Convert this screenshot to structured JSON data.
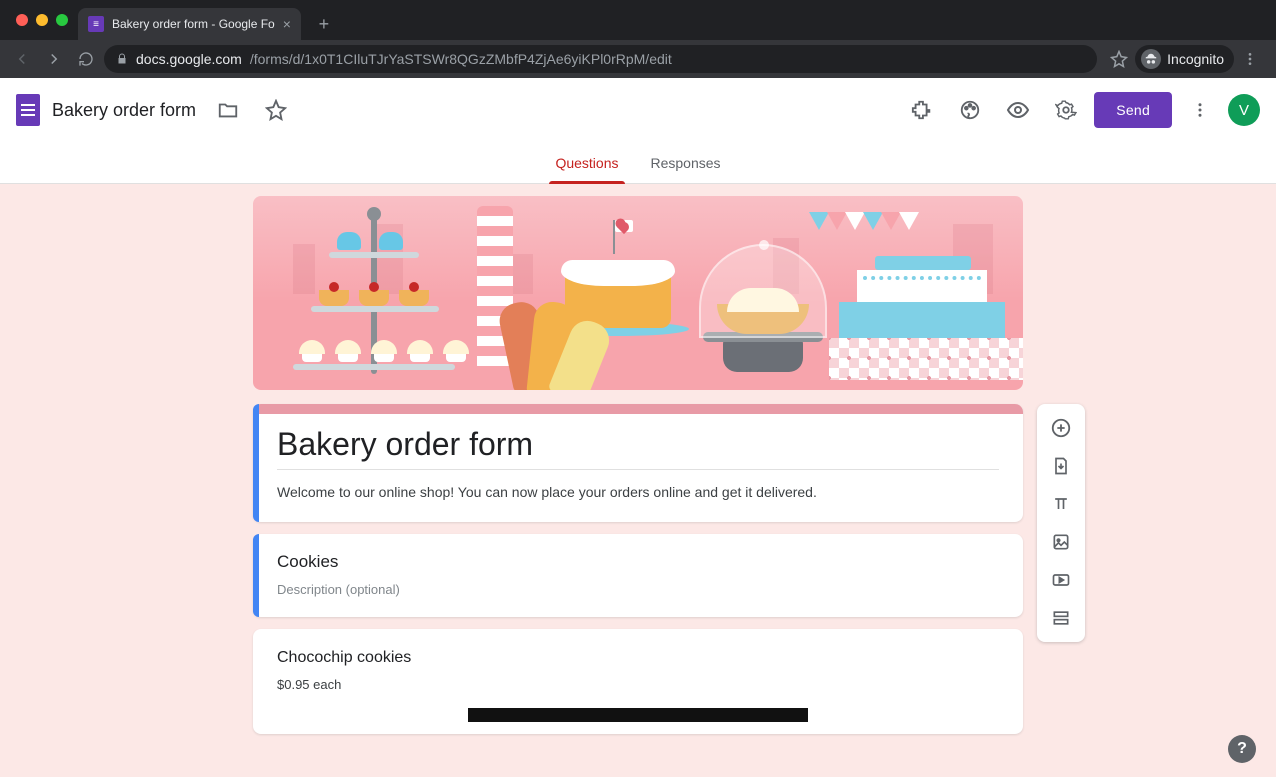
{
  "browser": {
    "tab_title": "Bakery order form - Google Fo",
    "url_host": "docs.google.com",
    "url_path": "/forms/d/1x0T1CIluTJrYaSTSWr8QGzZMbfP4ZjAe6yiKPl0rRpM/edit",
    "incognito_label": "Incognito"
  },
  "header": {
    "doc_title": "Bakery order form",
    "send_label": "Send",
    "avatar_letter": "V"
  },
  "tabs": {
    "questions": "Questions",
    "responses": "Responses",
    "active": "questions"
  },
  "form": {
    "title": "Bakery order form",
    "description": "Welcome to our online shop! You can now place your orders online and get it delivered."
  },
  "section": {
    "title": "Cookies",
    "desc_placeholder": "Description (optional)"
  },
  "question": {
    "title": "Chocochip cookies",
    "subtitle": "$0.95 each"
  },
  "toolbar": {
    "add_question": "Add question",
    "import": "Import questions",
    "add_title": "Add title and description",
    "add_image": "Add image",
    "add_video": "Add video",
    "add_section": "Add section"
  },
  "colors": {
    "accent": "#673ab7",
    "active_tab": "#c5221f",
    "canvas": "#fce8e6",
    "theme_header": "#e89aa6"
  }
}
